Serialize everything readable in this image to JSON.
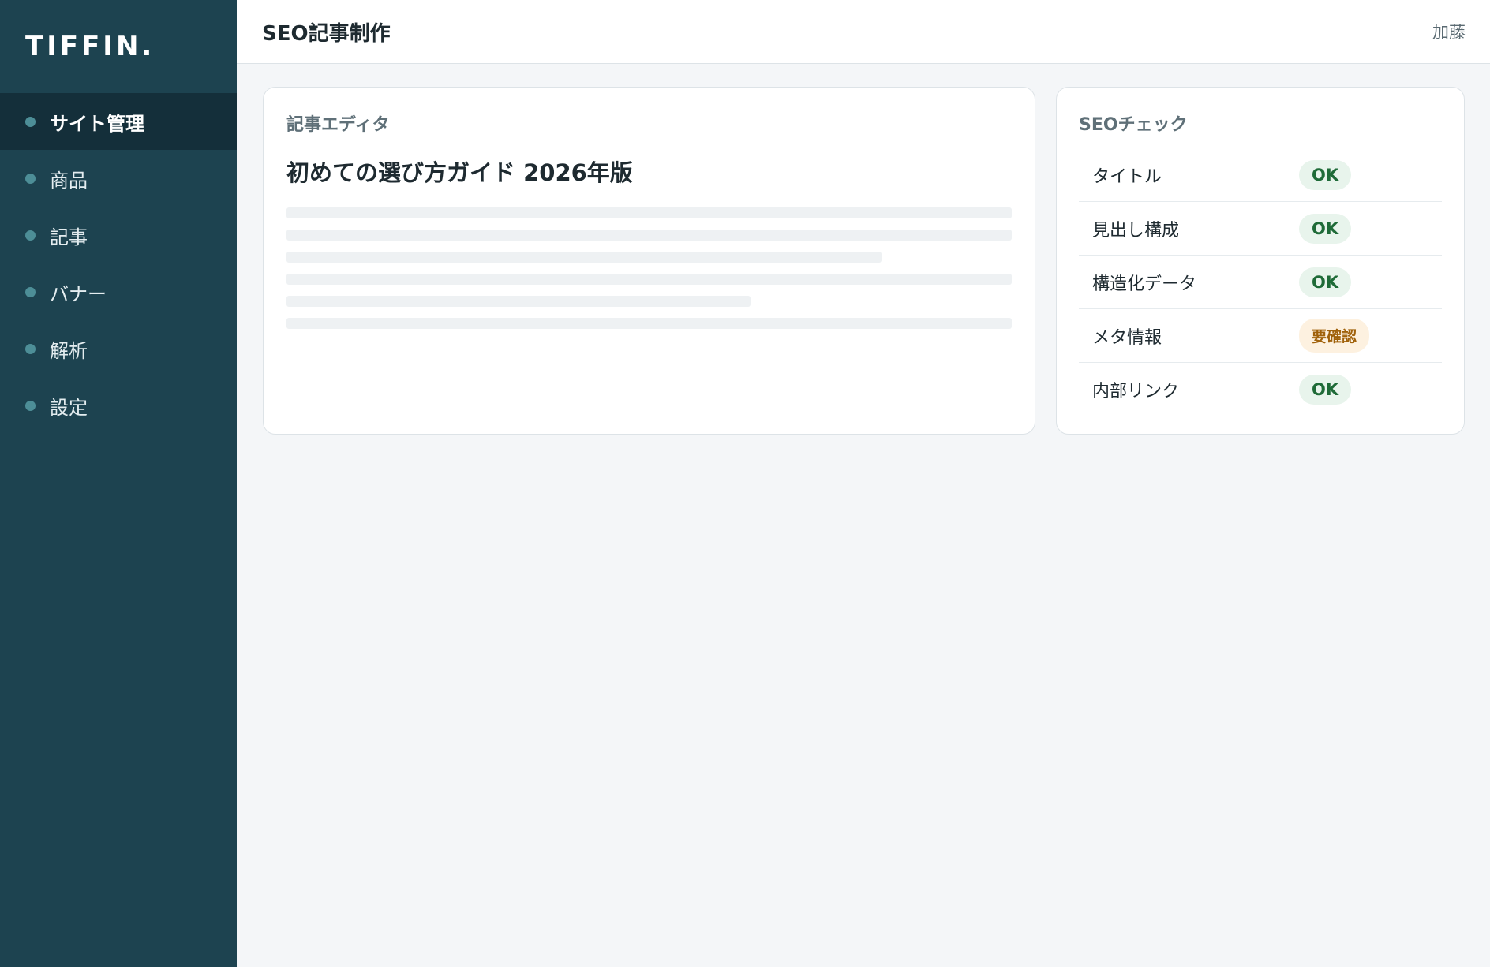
{
  "brand": {
    "logo": "TIFFIN."
  },
  "sidebar": {
    "items": [
      {
        "label": "サイト管理",
        "active": true
      },
      {
        "label": "商品",
        "active": false
      },
      {
        "label": "記事",
        "active": false
      },
      {
        "label": "バナー",
        "active": false
      },
      {
        "label": "解析",
        "active": false
      },
      {
        "label": "設定",
        "active": false
      }
    ]
  },
  "header": {
    "title": "SEO記事制作",
    "user": "加藤"
  },
  "editor": {
    "label": "記事エディタ",
    "article_title": "初めての選び方ガイド 2026年版"
  },
  "seo": {
    "label": "SEOチェック",
    "checks": [
      {
        "label": "タイトル",
        "status": "OK",
        "level": "ok"
      },
      {
        "label": "見出し構成",
        "status": "OK",
        "level": "ok"
      },
      {
        "label": "構造化データ",
        "status": "OK",
        "level": "ok"
      },
      {
        "label": "メタ情報",
        "status": "要確認",
        "level": "warn"
      },
      {
        "label": "内部リンク",
        "status": "OK",
        "level": "ok"
      }
    ]
  },
  "colors": {
    "sidebar_bg": "#1d4350",
    "sidebar_active": "#142f3a",
    "ok_text": "#1f6b38",
    "ok_bg": "#e8f4ec",
    "warn_text": "#a0610a",
    "warn_bg": "#fdf1e0"
  }
}
